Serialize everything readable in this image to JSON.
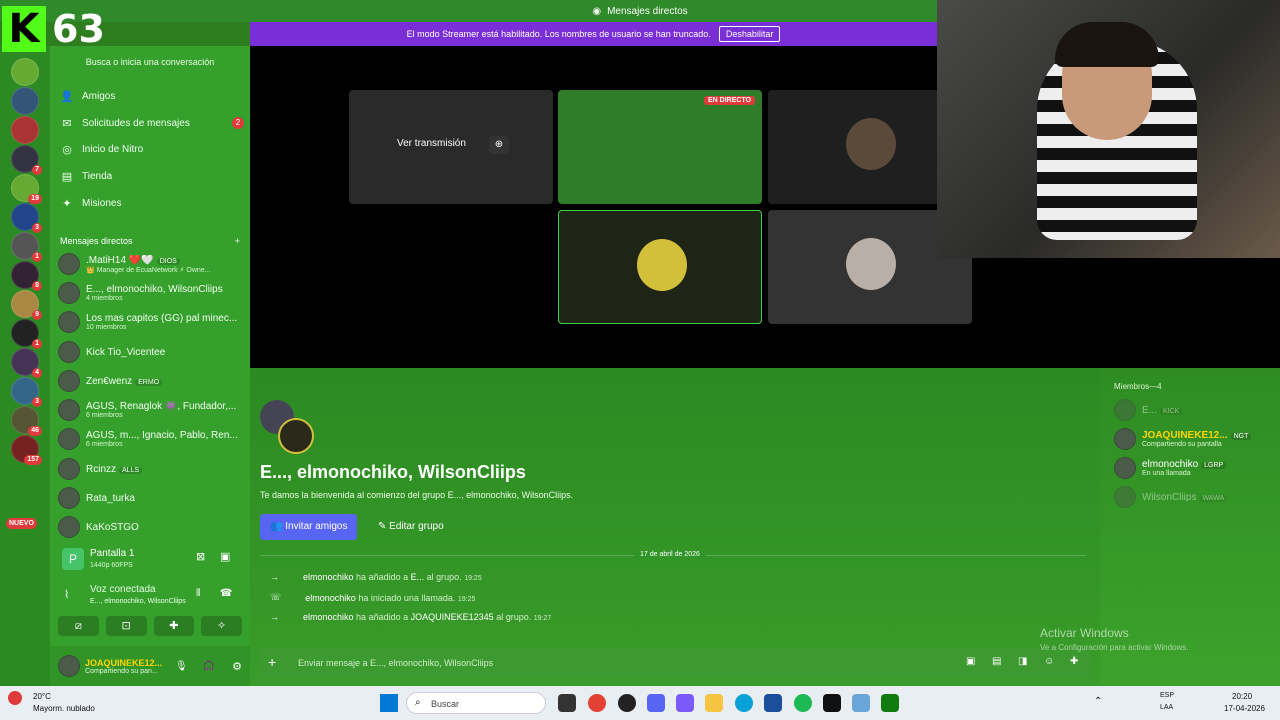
{
  "title_bar": {
    "icon": "discord-icon",
    "title": "Mensajes directos"
  },
  "banner": {
    "text": "El modo Streamer está habilitado. Los nombres de usuario se han truncado.",
    "button": "Deshabilitar"
  },
  "overlay": {
    "logo": "K",
    "count": "63"
  },
  "servers": [
    {
      "badge": ""
    },
    {
      "badge": ""
    },
    {
      "badge": ""
    },
    {
      "badge": "7"
    },
    {
      "badge": "19"
    },
    {
      "badge": "3"
    },
    {
      "badge": "1"
    },
    {
      "badge": "8"
    },
    {
      "badge": "9"
    },
    {
      "badge": "1"
    },
    {
      "badge": "4"
    },
    {
      "badge": "3"
    },
    {
      "badge": "46"
    },
    {
      "badge": "157"
    }
  ],
  "servers_new": "NUEVO",
  "dm": {
    "search": "Busca o inicia una conversación",
    "nav": [
      {
        "icon": "friends-icon",
        "label": "Amigos"
      },
      {
        "icon": "mail-icon",
        "label": "Solicitudes de mensajes",
        "badge": "2"
      },
      {
        "icon": "nitro-icon",
        "label": "Inicio de Nitro"
      },
      {
        "icon": "shop-icon",
        "label": "Tienda"
      },
      {
        "icon": "quests-icon",
        "label": "Misiones"
      }
    ],
    "header": "Mensajes directos",
    "add": "+",
    "items": [
      {
        "name": ".MatiH14 ❤️🤍",
        "tag": "DIOS",
        "sub": "👑 Manager de EcuaNetwork ⚡ Owne..."
      },
      {
        "name": "E..., elmonochiko, WilsonCliips",
        "sub": "4 miembros"
      },
      {
        "name": "Los mas capitos (GG) pal minec...",
        "sub": "10 miembros"
      },
      {
        "name": "Kick Tio_Vicentee",
        "sub": ""
      },
      {
        "name": "Zen€wenz",
        "tag": "ERMO",
        "sub": ""
      },
      {
        "name": "AGUS, Renaglok 👾, Fundador,...",
        "sub": "6 miembros"
      },
      {
        "name": "AGUS, m..., Ignacio, Pablo, Ren...",
        "sub": "6 miembros"
      },
      {
        "name": "Rcinzz",
        "tag": "ALLS",
        "sub": ""
      },
      {
        "name": "Rata_turka",
        "sub": ""
      },
      {
        "name": "KaKoSTGO",
        "sub": ""
      }
    ],
    "screen": {
      "title": "Pantalla 1",
      "sub": "1440p 60FPS"
    },
    "voice": {
      "title": "Voz conectada",
      "sub": "E..., elmonochiko, WilsonCliips"
    },
    "user": {
      "name": "JOAQUINEKE12...",
      "status": "Compartiendo su pan..."
    }
  },
  "stage": {
    "watch": "Ver transmisión",
    "live": "EN DIRECTO"
  },
  "chat": {
    "group_title": "E..., elmonochiko, WilsonCliips",
    "welcome": "Te damos la bienvenida al comienzo del grupo E..., elmonochiko, WilsonCliips.",
    "invite": "Invitar amigos",
    "edit": "Editar grupo",
    "date": "17 de abril de 2026",
    "messages": [
      {
        "icon": "arrow-icon",
        "user": "elmonochiko",
        "text": "ha añadido a",
        "target": "E...",
        "after": "al grupo.",
        "time": "19:25"
      },
      {
        "icon": "phone-icon",
        "user": "elmonochiko",
        "text": "ha iniciado una llamada.",
        "target": "",
        "after": "",
        "time": "19:25"
      },
      {
        "icon": "arrow-icon",
        "user": "elmonochiko",
        "text": "ha añadido a",
        "target": "JOAQUINEKE12345",
        "after": "al grupo.",
        "time": "19:27"
      }
    ],
    "placeholder": "Enviar mensaje a E..., elmonochiko, WilsonCliips"
  },
  "members": {
    "header": "Miembros—4",
    "list": [
      {
        "name": "E...",
        "tag": "KICK",
        "sub": ""
      },
      {
        "name": "JOAQUINEKE12...",
        "tag": "NGT",
        "sub": "Compartiendo su pantalla"
      },
      {
        "name": "elmonochiko",
        "tag": "LGRP",
        "sub": "En una llamada"
      },
      {
        "name": "WilsonCliips",
        "tag": "WAWA",
        "sub": ""
      }
    ]
  },
  "watermark": {
    "title": "Activar Windows",
    "sub": "Ve a Configuración para activar Windows."
  },
  "taskbar": {
    "temp": "20°C",
    "weather": "Mayorm. nublado",
    "search": "Buscar",
    "lang": "ESP",
    "lang2": "LAA",
    "time": "20:20",
    "date": "17-04-2026"
  }
}
